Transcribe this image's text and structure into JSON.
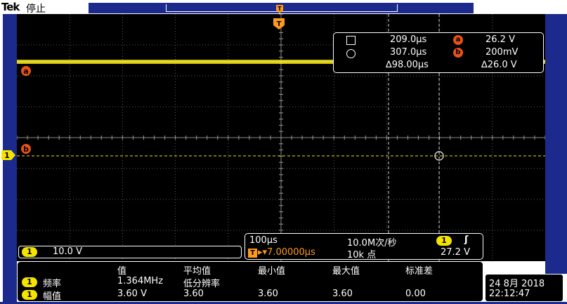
{
  "header": {
    "brand": "Tek",
    "status": "停止"
  },
  "markers": {
    "trigger_top": "T",
    "trigger_screen": "T",
    "ref_a": "a",
    "ref_b_trace": "b",
    "ch1": "1"
  },
  "cursor": {
    "row1_time": "209.0µs",
    "row1_badge": "a",
    "row1_volt": "26.2 V",
    "row2_time": "307.0µs",
    "row2_badge": "b",
    "row2_volt": "200mV",
    "delta_time": "∆98.00µs",
    "delta_volt": "∆26.0 V"
  },
  "ch1_scale": {
    "badge": "1",
    "value": "10.0 V"
  },
  "horizontal": {
    "timebase": "100µs",
    "sample_rate": "10.0M次/秒",
    "trig_badge": "1",
    "trig_edge": "ʃ",
    "trig_pos_badge": "T",
    "trig_pos": "▸▾7.00000µs",
    "record_length": "10k 点",
    "trig_level": "27.2 V"
  },
  "measurements": {
    "headers": [
      "值",
      "平均值",
      "最小值",
      "最大值",
      "标准差"
    ],
    "rows": [
      {
        "badge": "1",
        "label": "频率",
        "value": "1.364MHz",
        "mean": "低分辨率",
        "min": "",
        "max": "",
        "std": ""
      },
      {
        "badge": "1",
        "label": "幅值",
        "value": "3.60 V",
        "mean": "3.60",
        "min": "3.60",
        "max": "3.60",
        "std": "0.00"
      }
    ]
  },
  "datetime": {
    "date": "24 8月  2018",
    "time": "22:12:47"
  },
  "colors": {
    "trace": "#f5e400",
    "cursor_marker": "#e8521a",
    "trigger_marker": "#ff9a1f",
    "frame": "#1b2a8c"
  }
}
